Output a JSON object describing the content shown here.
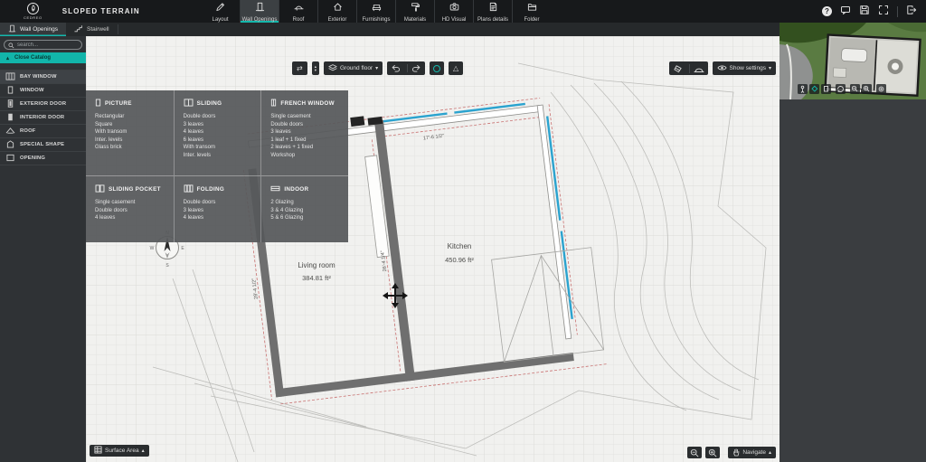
{
  "brand": "CEDREO",
  "title": "SLOPED TERRAIN",
  "glyphs": {
    "help": "?",
    "swap": "⇄",
    "caret_up": "▴",
    "caret_down": "▾",
    "triangle": "△"
  },
  "top_toolbar": {
    "items": [
      {
        "label": "Layout",
        "icon": "pencil-icon",
        "active": false
      },
      {
        "label": "Wall Openings",
        "icon": "wall-opening-icon",
        "active": true
      },
      {
        "label": "Roof",
        "icon": "roof-icon",
        "active": false
      },
      {
        "label": "Exterior",
        "icon": "house-icon",
        "active": false
      },
      {
        "label": "Furnishings",
        "icon": "sofa-icon",
        "active": false
      },
      {
        "label": "Materials",
        "icon": "paint-roller-icon",
        "active": false
      },
      {
        "label": "HD Visual",
        "icon": "camera-icon",
        "active": false
      },
      {
        "label": "Plans details",
        "icon": "document-icon",
        "active": false
      },
      {
        "label": "Folder",
        "icon": "folder-icon",
        "active": false
      }
    ]
  },
  "top_right_icons": [
    "help-icon",
    "feedback-icon",
    "save-icon",
    "fullscreen-icon",
    "exit-icon"
  ],
  "tabs": [
    {
      "label": "Wall Openings",
      "icon": "wall-opening-icon",
      "active": true
    },
    {
      "label": "Stairwell",
      "icon": "stairs-icon",
      "active": false
    }
  ],
  "sidebar": {
    "search_placeholder": "search...",
    "close_catalog_label": "Close Catalog",
    "categories": [
      {
        "label": "BAY WINDOW",
        "icon": "bay-window-icon",
        "selected": true
      },
      {
        "label": "WINDOW",
        "icon": "window-icon",
        "selected": false
      },
      {
        "label": "EXTERIOR DOOR",
        "icon": "exterior-door-icon",
        "selected": false
      },
      {
        "label": "INTERIOR DOOR",
        "icon": "interior-door-icon",
        "selected": false
      },
      {
        "label": "ROOF",
        "icon": "roof-icon",
        "selected": false
      },
      {
        "label": "SPECIAL SHAPE",
        "icon": "special-shape-icon",
        "selected": false
      },
      {
        "label": "OPENING",
        "icon": "opening-icon",
        "selected": false
      }
    ]
  },
  "catalog_popup": {
    "groups": [
      {
        "title": "PICTURE",
        "icon": "picture-window-icon",
        "items": [
          "Rectangular",
          "Square",
          "With transom",
          "Inter. levels",
          "Glass brick"
        ]
      },
      {
        "title": "SLIDING",
        "icon": "sliding-window-icon",
        "items": [
          "Double doors",
          "3 leaves",
          "4 leaves",
          "6 leaves",
          "With transom",
          "Inter. levels"
        ]
      },
      {
        "title": "FRENCH WINDOW",
        "icon": "french-window-icon",
        "items": [
          "Single casement",
          "Double doors",
          "3 leaves",
          "1 leaf + 1 fixed",
          "2 leaves + 1 fixed",
          "Workshop"
        ]
      },
      {
        "title": "SLIDING POCKET",
        "icon": "sliding-pocket-icon",
        "items": [
          "Single casement",
          "Double doors",
          "4 leaves"
        ]
      },
      {
        "title": "FOLDING",
        "icon": "folding-door-icon",
        "items": [
          "Double doors",
          "3 leaves",
          "4 leaves"
        ]
      },
      {
        "title": "INDOOR",
        "icon": "indoor-window-icon",
        "items": [
          "2 Glazing",
          "3 & 4 Glazing",
          "5 & 6 Glazing"
        ]
      }
    ]
  },
  "canvas_toolbar": {
    "floor_selector": "Ground floor",
    "show_settings_label": "Show settings",
    "icons": [
      "swap-icon",
      "floor-stepper",
      "floor-icon",
      "undo-icon",
      "redo-icon",
      "render-icon",
      "triangle-ruler-icon",
      "eraser-icon",
      "dome-icon",
      "eye-icon"
    ]
  },
  "bottom_bar": {
    "surface_area_label": "Surface Area",
    "navigate_label": "Navigate",
    "icons": [
      "table-icon",
      "zoom-out-icon",
      "zoom-in-icon",
      "hand-icon"
    ]
  },
  "preview_icons": [
    "walk-icon",
    "view-3d-icon",
    "plan-icon",
    "orbit-icon",
    "zoom-out-icon",
    "zoom-in-icon",
    "target-icon"
  ],
  "plan": {
    "rooms": [
      {
        "name": "Living room",
        "area": "384.81 ft²"
      },
      {
        "name": "Kitchen",
        "area": "450.96 ft²"
      }
    ],
    "dimensions": {
      "top": "17'-6 1/2\"",
      "middle": "26'-4 1/4\"",
      "left": "28'-4 1/2\""
    },
    "compass": {
      "n": "N",
      "s": "S",
      "e": "E",
      "w": "W"
    },
    "colors": {
      "window_blue": "#2ba3cf",
      "wall_gray": "#6f6f6f",
      "dimension_red": "#c97272",
      "accent_teal": "#14b8ac"
    }
  }
}
